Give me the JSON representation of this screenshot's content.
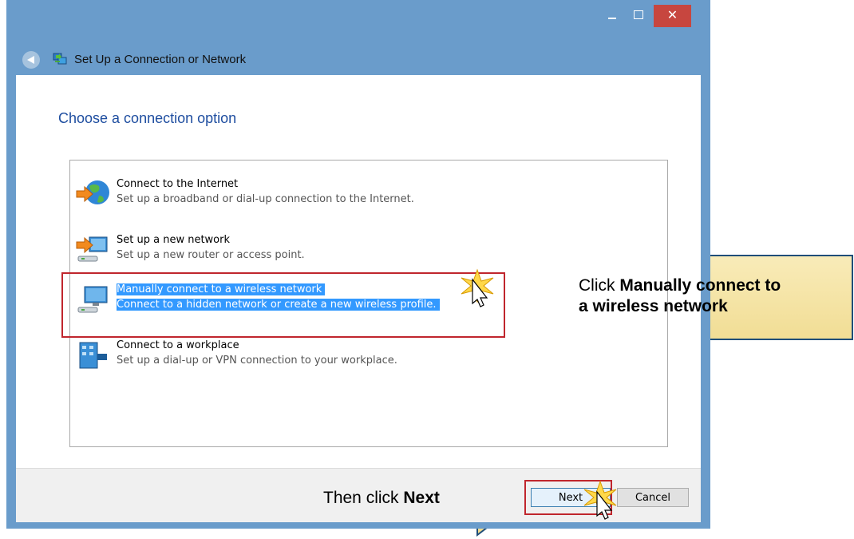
{
  "window": {
    "title": "Set Up a Connection or Network",
    "close_glyph": "✕"
  },
  "heading": "Choose a connection option",
  "options": [
    {
      "title": "Connect to the Internet",
      "desc": "Set up a broadband or dial-up connection to the Internet.",
      "icon": "globe-internet-icon"
    },
    {
      "title": "Set up a new network",
      "desc": "Set up a new router or access point.",
      "icon": "router-network-icon"
    },
    {
      "title": "Manually connect to a wireless network",
      "desc": "Connect to a hidden network or create a new wireless profile.",
      "icon": "wireless-monitor-icon",
      "selected": true
    },
    {
      "title": "Connect to a workplace",
      "desc": "Set up a dial-up or VPN connection to your workplace.",
      "icon": "workplace-building-icon"
    }
  ],
  "buttons": {
    "next": "Next",
    "cancel": "Cancel"
  },
  "callouts": {
    "option_prefix": "Click ",
    "option_bold": "Manually connect to",
    "option_bold2": "a wireless network",
    "next_prefix": "Then click ",
    "next_bold": "Next"
  },
  "colors": {
    "titlebar": "#6a9ccb",
    "close_button": "#c7463f",
    "heading": "#1f4ea0",
    "selection": "#3399ff",
    "highlight_border": "#c0262d",
    "callout_fill": "#f7e6a4",
    "callout_stroke": "#1f4e79"
  }
}
